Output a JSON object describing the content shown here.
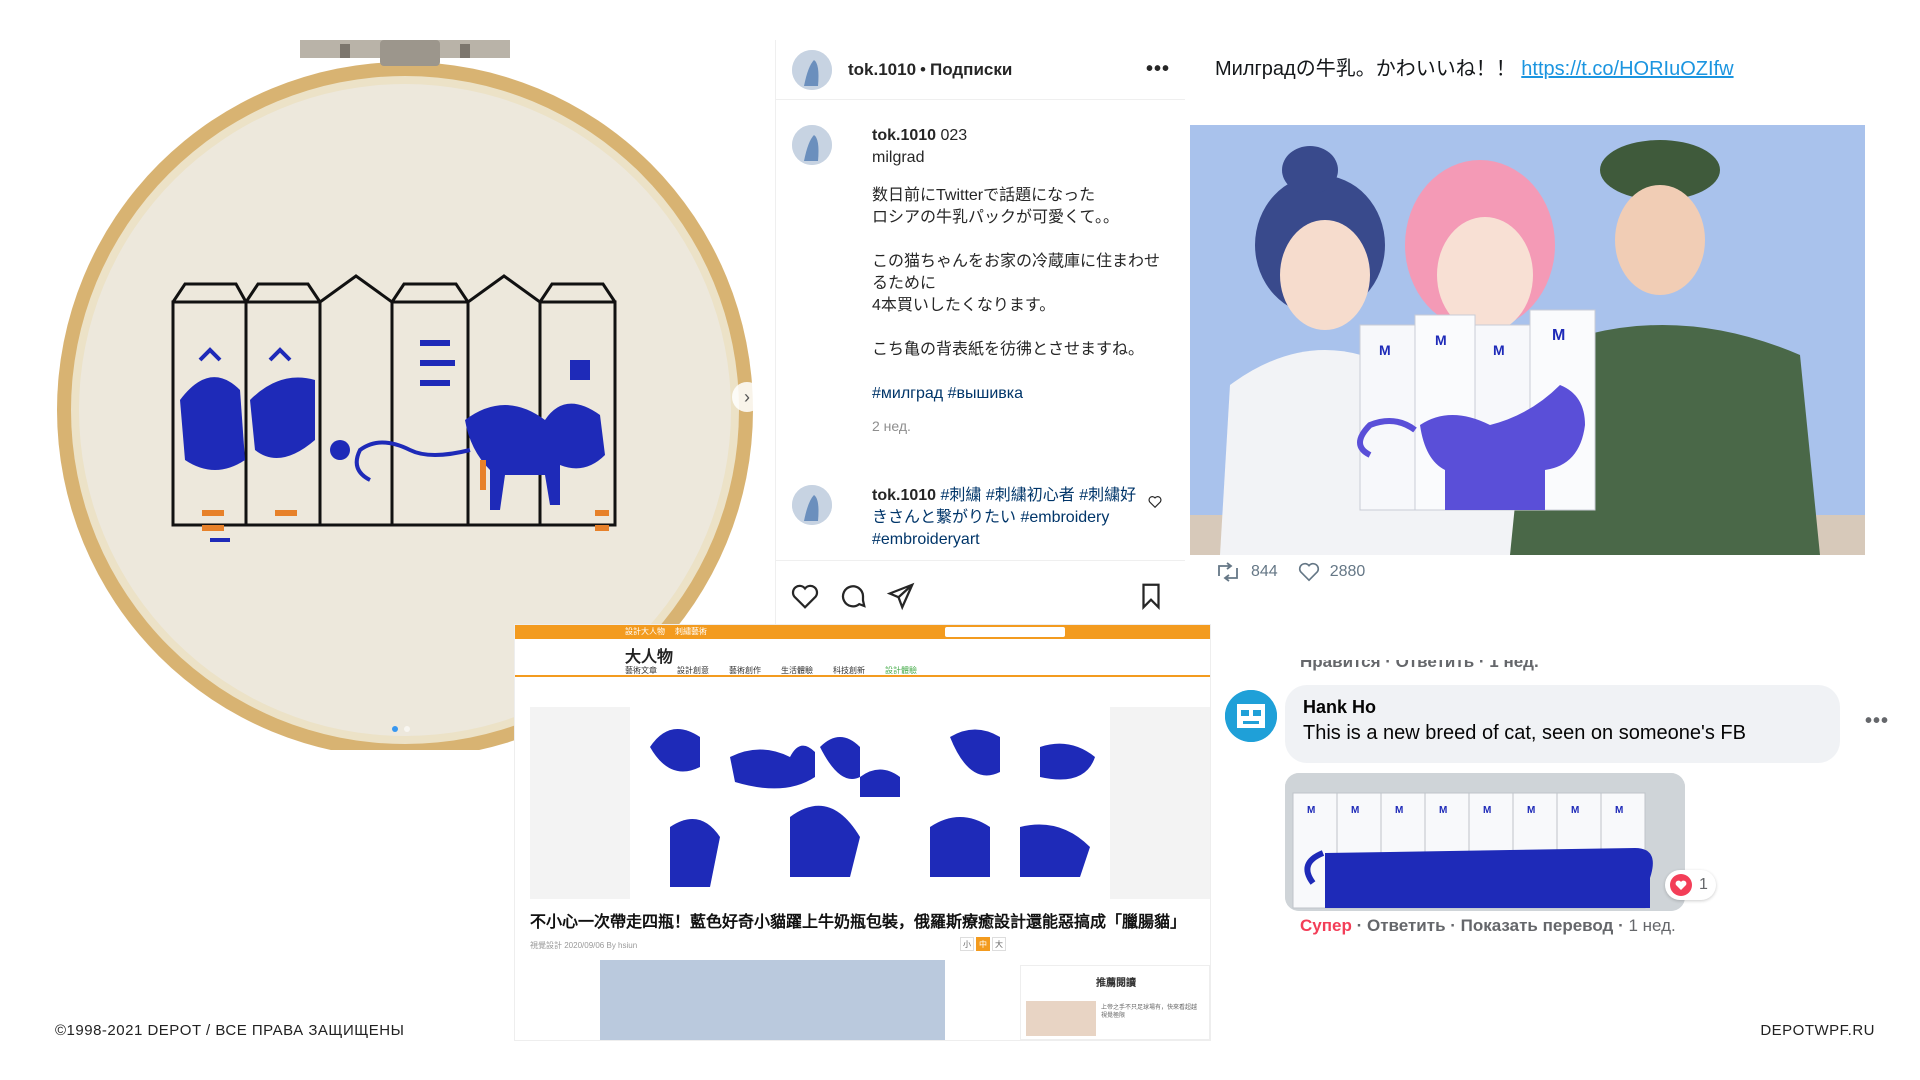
{
  "colors": {
    "cat_blue": "#1e2ab8",
    "ig_link": "#003569",
    "tw_link": "#1b95e0",
    "fb_super": "#f33e58",
    "art_orange": "#f39b1f"
  },
  "instagram": {
    "username": "tok.1010",
    "separator": "•",
    "follow_label": "Подписки",
    "more_icon": "more-horizontal-icon",
    "caption_header": "tok.1010 023",
    "caption_line2": "milgrad",
    "paragraphs": [
      "数日前にTwitterで話題になった\nロシアの牛乳パックが可愛くて。。",
      "この猫ちゃんをお家の冷蔵庫に住まわせるために\n4本買いしたくなります。",
      "こち亀の背表紙を彷彿とさせますね。"
    ],
    "hashtags": "#милград #вышивка",
    "time": "2 нед.",
    "comment_user": "tok.1010",
    "comment_text": "#刺繍 #刺繍初心者 #刺繍好きさんと繋がりたい #embroidery #embroideryart",
    "action_icons": [
      "heart-icon",
      "comment-icon",
      "share-icon",
      "bookmark-icon"
    ]
  },
  "twitter": {
    "text": "Милградの牛乳。かわいいね！！",
    "link": "https://t.co/HORIuOZIfw",
    "retweets": "844",
    "likes": "2880"
  },
  "article": {
    "top_left": "設計大人物",
    "top_mid": "刺繡藝術",
    "logo": "大人物",
    "menu": [
      "藝術文章",
      "設計創意",
      "藝術創作",
      "生活體驗",
      "科技創新",
      "設計體驗"
    ],
    "title": "不小心一次帶走四瓶！藍色好奇小貓躍上牛奶瓶包裝，俄羅斯療癒設計還能惡搞成「臘腸貓」",
    "meta": "視覺設計 2020/09/06 By hsiun",
    "sizes": [
      "小",
      "中",
      "大"
    ],
    "side_heading": "推薦閱讀",
    "side_text": "上帝之手不只足球場有，快來看超越視覺極限"
  },
  "facebook": {
    "cut_line": "Нравится · Ответить · 1 нед.",
    "name": "Hank Ho",
    "message": "This is a new breed of cat, seen on someone's FB",
    "reaction_count": "1",
    "actions": {
      "super": "Супер",
      "reply": "Ответить",
      "translate": "Показать перевод",
      "time": "1 нед."
    }
  },
  "footer": {
    "copyright": "©1998-2021 DEPOT / ВСЕ ПРАВА ЗАЩИЩЕНЫ",
    "site": "DEPOTWPF.RU"
  }
}
